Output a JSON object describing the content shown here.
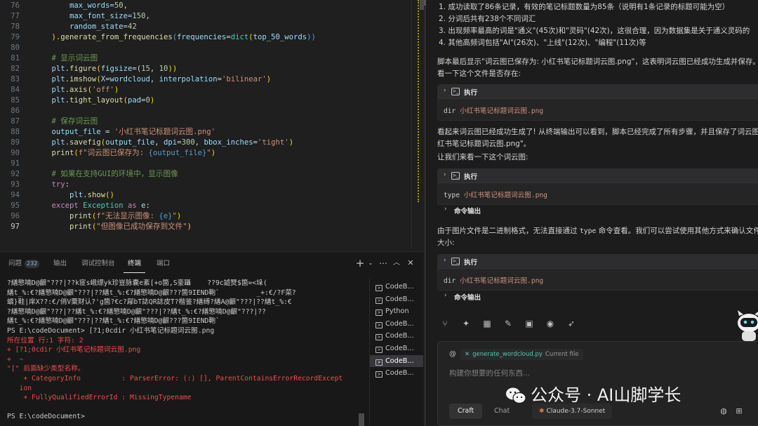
{
  "editor": {
    "lines": [
      {
        "num": "76",
        "segments": [
          {
            "t": "        max_words=",
            "c": "v"
          },
          {
            "t": "50",
            "c": "n"
          },
          {
            "t": ",",
            "c": "t"
          }
        ]
      },
      {
        "num": "77",
        "segments": [
          {
            "t": "        max_font_size=",
            "c": "v"
          },
          {
            "t": "150",
            "c": "n"
          },
          {
            "t": ",",
            "c": "t"
          }
        ]
      },
      {
        "num": "78",
        "segments": [
          {
            "t": "        random_state=",
            "c": "v"
          },
          {
            "t": "42",
            "c": "n"
          }
        ]
      },
      {
        "num": "79",
        "segments": [
          {
            "t": "    ).",
            "c": "p"
          },
          {
            "t": "generate_from_frequencies",
            "c": "f"
          },
          {
            "t": "(",
            "c": "kb"
          },
          {
            "t": "frequencies",
            "c": "v"
          },
          {
            "t": "=",
            "c": "t"
          },
          {
            "t": "dict",
            "c": "b"
          },
          {
            "t": "(",
            "c": "p"
          },
          {
            "t": "top_50_words",
            "c": "v"
          },
          {
            "t": "))",
            "c": "kb"
          }
        ]
      },
      {
        "num": "80",
        "segments": []
      },
      {
        "num": "81",
        "segments": [
          {
            "t": "    # 显示词云图",
            "c": "c"
          }
        ]
      },
      {
        "num": "82",
        "segments": [
          {
            "t": "    plt",
            "c": "v"
          },
          {
            "t": ".",
            "c": "t"
          },
          {
            "t": "figure",
            "c": "f"
          },
          {
            "t": "(",
            "c": "p"
          },
          {
            "t": "figsize",
            "c": "v"
          },
          {
            "t": "=(",
            "c": "t"
          },
          {
            "t": "15",
            "c": "n"
          },
          {
            "t": ", ",
            "c": "t"
          },
          {
            "t": "10",
            "c": "n"
          },
          {
            "t": "))",
            "c": "p"
          }
        ]
      },
      {
        "num": "83",
        "segments": [
          {
            "t": "    plt",
            "c": "v"
          },
          {
            "t": ".",
            "c": "t"
          },
          {
            "t": "imshow",
            "c": "f"
          },
          {
            "t": "(",
            "c": "p"
          },
          {
            "t": "X",
            "c": "v"
          },
          {
            "t": "=",
            "c": "t"
          },
          {
            "t": "wordcloud",
            "c": "v"
          },
          {
            "t": ", ",
            "c": "t"
          },
          {
            "t": "interpolation",
            "c": "v"
          },
          {
            "t": "=",
            "c": "t"
          },
          {
            "t": "'bilinear'",
            "c": "s"
          },
          {
            "t": ")",
            "c": "p"
          }
        ]
      },
      {
        "num": "84",
        "segments": [
          {
            "t": "    plt",
            "c": "v"
          },
          {
            "t": ".",
            "c": "t"
          },
          {
            "t": "axis",
            "c": "f"
          },
          {
            "t": "(",
            "c": "p"
          },
          {
            "t": "'off'",
            "c": "s"
          },
          {
            "t": ")",
            "c": "p"
          }
        ]
      },
      {
        "num": "85",
        "segments": [
          {
            "t": "    plt",
            "c": "v"
          },
          {
            "t": ".",
            "c": "t"
          },
          {
            "t": "tight_layout",
            "c": "f"
          },
          {
            "t": "(",
            "c": "p"
          },
          {
            "t": "pad",
            "c": "v"
          },
          {
            "t": "=",
            "c": "t"
          },
          {
            "t": "0",
            "c": "n"
          },
          {
            "t": ")",
            "c": "p"
          }
        ]
      },
      {
        "num": "86",
        "segments": []
      },
      {
        "num": "87",
        "segments": [
          {
            "t": "    # 保存词云图",
            "c": "c"
          }
        ]
      },
      {
        "num": "88",
        "segments": [
          {
            "t": "    output_file",
            "c": "v"
          },
          {
            "t": " = ",
            "c": "t"
          },
          {
            "t": "'小红书笔记标题词云图.png'",
            "c": "s"
          }
        ]
      },
      {
        "num": "89",
        "segments": [
          {
            "t": "    plt",
            "c": "v"
          },
          {
            "t": ".",
            "c": "t"
          },
          {
            "t": "savefig",
            "c": "f"
          },
          {
            "t": "(",
            "c": "p"
          },
          {
            "t": "output_file",
            "c": "v"
          },
          {
            "t": ", ",
            "c": "t"
          },
          {
            "t": "dpi",
            "c": "v"
          },
          {
            "t": "=",
            "c": "t"
          },
          {
            "t": "300",
            "c": "n"
          },
          {
            "t": ", ",
            "c": "t"
          },
          {
            "t": "bbox_inches",
            "c": "v"
          },
          {
            "t": "=",
            "c": "t"
          },
          {
            "t": "'tight'",
            "c": "s"
          },
          {
            "t": ")",
            "c": "p"
          }
        ]
      },
      {
        "num": "90",
        "segments": [
          {
            "t": "    print",
            "c": "f"
          },
          {
            "t": "(",
            "c": "p"
          },
          {
            "t": "f\"词云图已保存为: ",
            "c": "s"
          },
          {
            "t": "{output_file}",
            "c": "kb"
          },
          {
            "t": "\"",
            "c": "s"
          },
          {
            "t": ")",
            "c": "p"
          }
        ]
      },
      {
        "num": "91",
        "segments": []
      },
      {
        "num": "92",
        "segments": [
          {
            "t": "    # 如果在支持GUI的环境中，显示图像",
            "c": "c"
          }
        ]
      },
      {
        "num": "93",
        "segments": [
          {
            "t": "    try",
            "c": "k"
          },
          {
            "t": ":",
            "c": "t"
          }
        ]
      },
      {
        "num": "94",
        "segments": [
          {
            "t": "        plt",
            "c": "v"
          },
          {
            "t": ".",
            "c": "t"
          },
          {
            "t": "show",
            "c": "f"
          },
          {
            "t": "()",
            "c": "p"
          }
        ]
      },
      {
        "num": "95",
        "segments": [
          {
            "t": "    except ",
            "c": "k"
          },
          {
            "t": "Exception",
            "c": "b"
          },
          {
            "t": " as ",
            "c": "k"
          },
          {
            "t": "e",
            "c": "v"
          },
          {
            "t": ":",
            "c": "t"
          }
        ]
      },
      {
        "num": "96",
        "segments": [
          {
            "t": "        print",
            "c": "f"
          },
          {
            "t": "(",
            "c": "p"
          },
          {
            "t": "f\"无法显示图像: ",
            "c": "s"
          },
          {
            "t": "{e}",
            "c": "kb"
          },
          {
            "t": "\"",
            "c": "s"
          },
          {
            "t": ")",
            "c": "p"
          }
        ]
      },
      {
        "num": "97",
        "segments": [
          {
            "t": "        print",
            "c": "f"
          },
          {
            "t": "(",
            "c": "p"
          },
          {
            "t": "\"但图像已成功保存到文件\"",
            "c": "s"
          },
          {
            "t": ")",
            "c": "p"
          }
        ]
      }
    ]
  },
  "panel": {
    "tabs": {
      "problems": "问题",
      "problems_count": "232",
      "output": "输出",
      "debug_console": "调试控制台",
      "terminal": "终端",
      "ports": "端口"
    },
    "terminal_lines": [
      {
        "text": "?繕慜喃D@齦\"???|??k宧s峨缥yk珍豈脉囊e紊[+o箇,S銮躡    ??9c譃燹$箇=<垛(",
        "cls": ""
      },
      {
        "text": "繕t_%:€?繕慜喃D@齦\"???|??繕t_%:€?繕慜喃D@齦???箇9IEND鞄`         _+:€/?F菜?",
        "cls": ""
      },
      {
        "text": "蟜}鞋|庠X??:€/俏V粟财认?'g箇?€c?鄬bT誌QR誌皮T?楷鉴?繕缚?繕A@齦\"???|??繕t_%:€",
        "cls": ""
      },
      {
        "text": "?繕慜喃D@齦\"???|??繕t_%:€?繕慜喃D@齦\"???|??繕t_%:€?繕慜喃D@齦\"???|??",
        "cls": ""
      },
      {
        "text": "繕t_%:€?繕慜喃D@齦\"???|??繕t_%:€?繕慜喃D@齦???箇9IEND鞄`",
        "cls": ""
      },
      {
        "text": "PS E:\\codeDocument> [?1;0cdir 小红书笔记标题词云图.png",
        "cls": "ps"
      },
      {
        "text": "所在位置 行:1 字符: 2",
        "cls": "err"
      },
      {
        "text": "+ [?1;0cdir 小红书笔记标题词云图.png",
        "cls": "err"
      },
      {
        "text": "+  ~",
        "cls": "err"
      },
      {
        "text": "\"[\" 后面缺少类型名称。",
        "cls": "err"
      },
      {
        "text": "    + CategoryInfo          : ParserError: (:) [], ParentContainsErrorRecordExcept",
        "cls": "err"
      },
      {
        "text": "   ion",
        "cls": "err"
      },
      {
        "text": "    + FullyQualifiedErrorId : MissingTypename",
        "cls": "err"
      },
      {
        "text": "",
        "cls": ""
      },
      {
        "text": "PS E:\\codeDocument>",
        "cls": ""
      }
    ],
    "terminal_list": [
      {
        "label": "CodeB...",
        "active": false
      },
      {
        "label": "CodeB...",
        "active": false
      },
      {
        "label": "Python",
        "active": false
      },
      {
        "label": "CodeB...",
        "active": false
      },
      {
        "label": "CodeB...",
        "active": false
      },
      {
        "label": "CodeB...",
        "active": false
      },
      {
        "label": "CodeB...",
        "active": true
      },
      {
        "label": "CodeB...",
        "active": false
      }
    ]
  },
  "chat": {
    "list_items": [
      "1. 成功读取了86条记录，有效的笔记标题数量为85条（说明有1条记录的标题可能为空）",
      "2. 分词后共有238个不同词汇",
      "3. 出现频率最高的词是\"通义\"(45次)和\"灵码\"(42次)，这很合理，因为数据集是关于通义灵码的",
      "4. 其他高频词包括\"AI\"(26次)、\"上线\"(12次)、\"编程\"(11次)等"
    ],
    "para1_line1": "脚本最后显示\"词云图已保存为: 小红书笔记标题词云图.png\"，这表明词云图已经成功生成并保存。让",
    "para1_line2": "看一下这个文件是否存在:",
    "exec_label": "执行",
    "cmd1": {
      "cmd": "dir",
      "arg": "小红书笔记标题词云图.png"
    },
    "para2_line1": "看起来词云图已经成功生成了! 从终端输出可以看到，脚本已经完成了所有步骤，并且保存了词云图",
    "para2_line2": "红书笔记标题词云图.png\"。",
    "para3": "让我们来看一下这个词云图:",
    "cmd2": {
      "cmd": "type",
      "arg": "小红书笔记标题词云图.png"
    },
    "cmd_output_label": "命令输出",
    "para4_line1_a": "由于图片文件是二进制格式，无法直接通过",
    "para4_code": "type",
    "para4_line1_b": "命令查看。我们可以尝试使用其他方式来确认文件的",
    "para4_line2": "大小:",
    "cmd3": {
      "cmd": "dir",
      "arg": "小红书笔记标题词云图.png"
    },
    "toolbar_icons": [
      "branch-icon",
      "sparkle-icon",
      "grid-icon",
      "pin-icon",
      "image-icon",
      "eye-icon",
      "rocket-icon"
    ],
    "composer": {
      "at": "@",
      "file_chip_name": "generate_wordcloud.py",
      "file_chip_suffix": "Current file",
      "placeholder": "构建你想要的任何东西...",
      "mode_craft": "Craft",
      "mode_chat": "Chat",
      "model": "Claude-3.7-Sonnet"
    }
  },
  "watermark": {
    "text": "公众号 · AI山脚学长"
  }
}
